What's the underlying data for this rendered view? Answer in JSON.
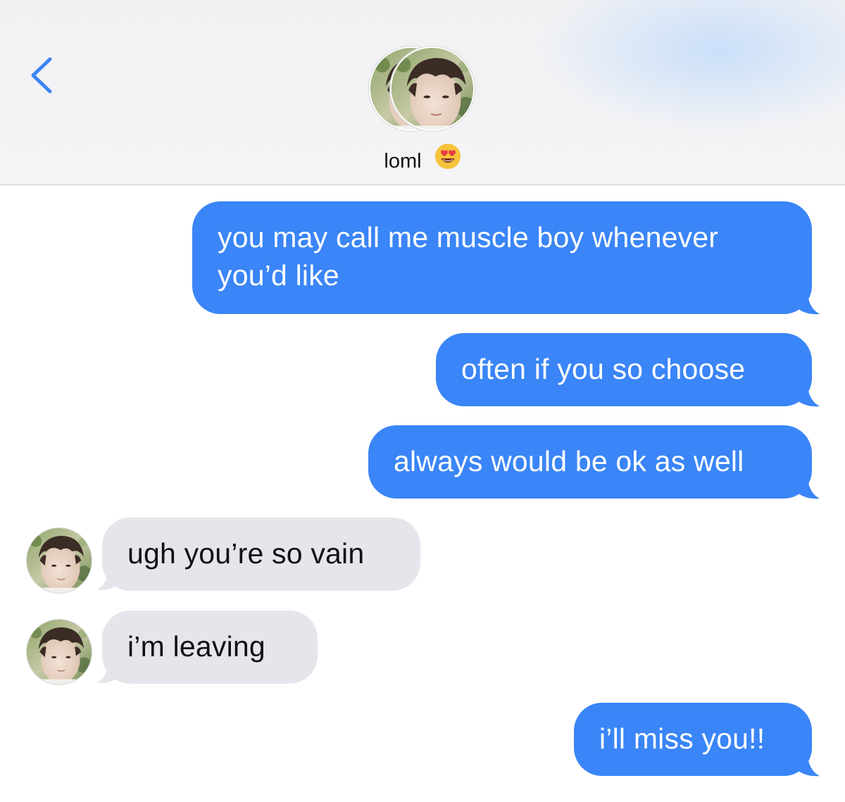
{
  "app": "Messages",
  "header": {
    "back_icon": "chevron-left-icon",
    "contact_name": "loml",
    "contact_emoji": "😍",
    "accent_color": "#3a85f7"
  },
  "messages": [
    {
      "direction": "outgoing",
      "text_lines": [
        "you may call me muscle boy whenever",
        "you’d like"
      ]
    },
    {
      "direction": "outgoing",
      "text": "often if you so choose"
    },
    {
      "direction": "outgoing",
      "text": "always would be ok as well"
    },
    {
      "direction": "incoming",
      "text": "ugh you’re so vain"
    },
    {
      "direction": "incoming",
      "text": "i’m leaving"
    },
    {
      "direction": "outgoing",
      "text": "i’ll miss you!!"
    }
  ],
  "colors": {
    "outgoing_bubble": "#3a85f7",
    "incoming_bubble": "#e6e5eb",
    "header_background": "#f2f2f4"
  }
}
